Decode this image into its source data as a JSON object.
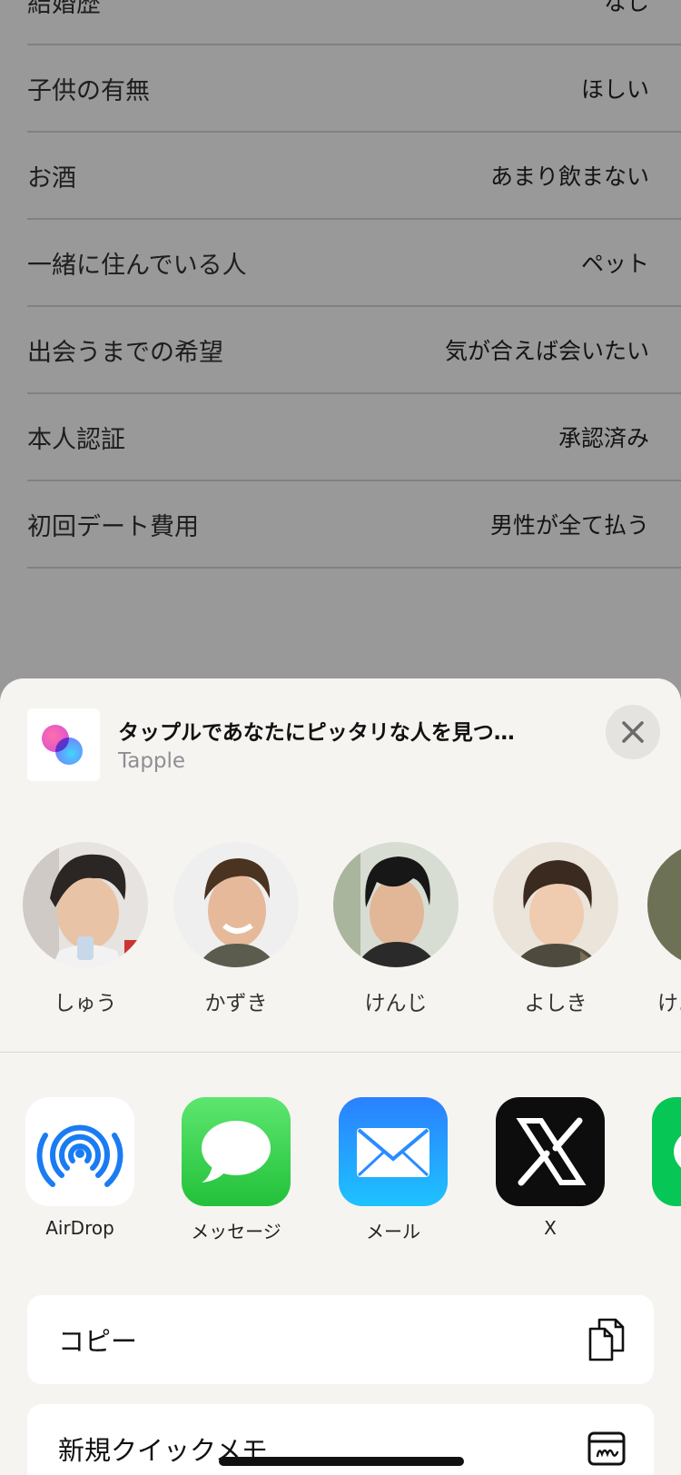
{
  "profile": {
    "rows": [
      {
        "label": "結婚歴",
        "value": "なし"
      },
      {
        "label": "子供の有無",
        "value": "ほしい"
      },
      {
        "label": "お酒",
        "value": "あまり飲まない"
      },
      {
        "label": "一緒に住んでいる人",
        "value": "ペット"
      },
      {
        "label": "出会うまでの希望",
        "value": "気が合えば会いたい"
      },
      {
        "label": "本人認証",
        "value": "承認済み"
      },
      {
        "label": "初回デート費用",
        "value": "男性が全て払う"
      }
    ]
  },
  "share_sheet": {
    "title": "タップルであなたにピッタリな人を見つ…",
    "subtitle": "Tapple",
    "contacts": [
      {
        "name": "しゅう"
      },
      {
        "name": "かずき"
      },
      {
        "name": "けんじ"
      },
      {
        "name": "よしき"
      },
      {
        "name": "け…"
      }
    ],
    "apps": [
      {
        "label": "AirDrop",
        "icon": "airdrop-icon"
      },
      {
        "label": "メッセージ",
        "icon": "messages-icon"
      },
      {
        "label": "メール",
        "icon": "mail-icon"
      },
      {
        "label": "X",
        "icon": "x-icon"
      },
      {
        "label": "",
        "icon": "line-icon"
      }
    ],
    "actions": [
      {
        "label": "コピー",
        "icon": "copy-icon"
      },
      {
        "label": "新規クイックメモ",
        "icon": "quick-note-icon"
      }
    ]
  },
  "colors": {
    "sheet_bg": "#f6f4f1",
    "messages_green": "#34c759",
    "mail_blue": "#1f8fff",
    "airdrop_blue": "#1a7cf3"
  }
}
